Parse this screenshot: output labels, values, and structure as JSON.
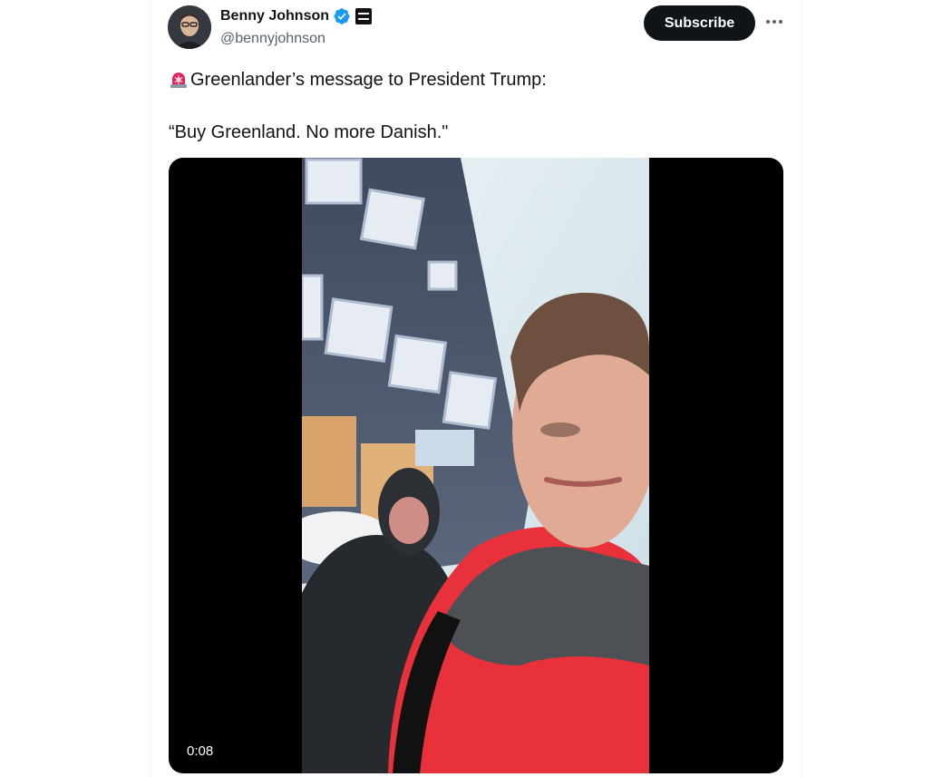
{
  "author": {
    "name": "Benny Johnson",
    "handle": "@bennyjohnson",
    "verified_icon": "verified-badge-icon",
    "affiliation_icon": "affiliate-badge-icon",
    "verified_color": "#1d9bf0"
  },
  "actions": {
    "subscribe_label": "Subscribe",
    "more_icon": "more-horizontal-icon"
  },
  "tweet": {
    "emoji": "rotating-light-icon",
    "line1": "Greenlander’s message to President Trump:",
    "line2": "“Buy Greenland. No more Danish.\""
  },
  "video": {
    "timestamp": "0:08"
  },
  "colors": {
    "text_primary": "#0f1419",
    "text_secondary": "#536471",
    "button_dark": "#0f1419"
  }
}
